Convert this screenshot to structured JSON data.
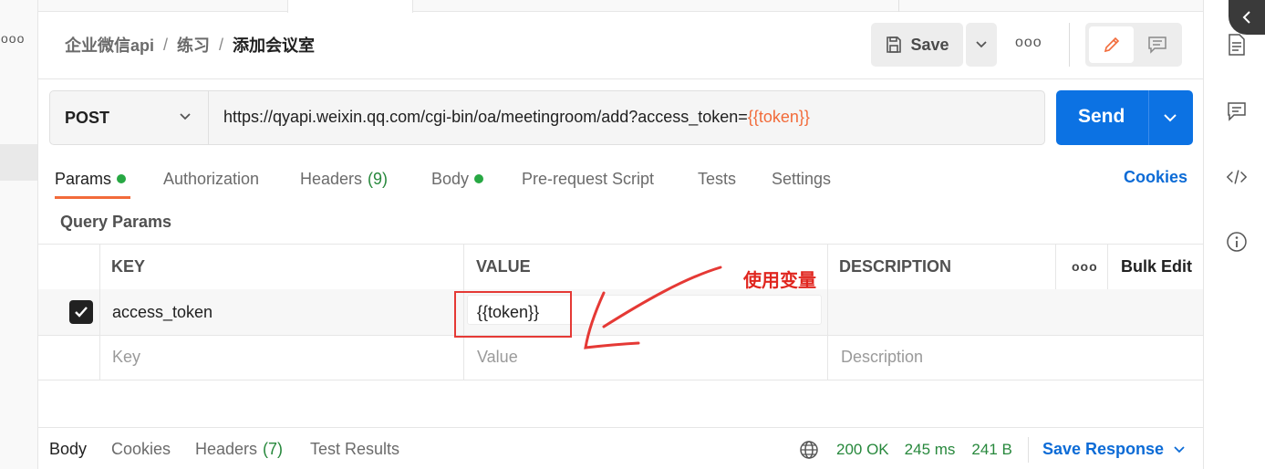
{
  "breadcrumb": {
    "collection": "企业微信api",
    "folder": "练习",
    "request": "添加会议室",
    "separator": "/"
  },
  "header": {
    "save_label": "Save",
    "more_icon": "ellipsis-icon",
    "edit_icon": "pencil-icon",
    "comment_icon": "comment-icon"
  },
  "request": {
    "method": "POST",
    "url_prefix": "https://qyapi.weixin.qq.com/cgi-bin/oa/meetingroom/add?access_token=",
    "url_variable": "{{token}}",
    "send_label": "Send"
  },
  "tabs": [
    {
      "label": "Params",
      "dot": true,
      "active": true
    },
    {
      "label": "Authorization"
    },
    {
      "label": "Headers",
      "count": "(9)"
    },
    {
      "label": "Body",
      "dot": true
    },
    {
      "label": "Pre-request Script"
    },
    {
      "label": "Tests"
    },
    {
      "label": "Settings"
    }
  ],
  "cookies_label": "Cookies",
  "query_params": {
    "title": "Query Params",
    "columns": {
      "key": "KEY",
      "value": "VALUE",
      "description": "DESCRIPTION",
      "bulk_edit": "Bulk Edit"
    },
    "rows": [
      {
        "checked": true,
        "key": "access_token",
        "value": "{{token}}",
        "description": ""
      }
    ],
    "placeholders": {
      "key": "Key",
      "value": "Value",
      "description": "Description"
    }
  },
  "annotation": {
    "text": "使用变量",
    "color": "#e0261f"
  },
  "response": {
    "tabs": [
      {
        "label": "Body",
        "active": true
      },
      {
        "label": "Cookies"
      },
      {
        "label": "Headers",
        "count": "(7)"
      },
      {
        "label": "Test Results"
      }
    ],
    "status": "200 OK",
    "time": "245 ms",
    "size": "241 B",
    "save_label": "Save Response"
  },
  "colors": {
    "accent": "#f26b3a",
    "send": "#0c72e3",
    "link": "#0c6bd6",
    "success": "#27883c"
  }
}
